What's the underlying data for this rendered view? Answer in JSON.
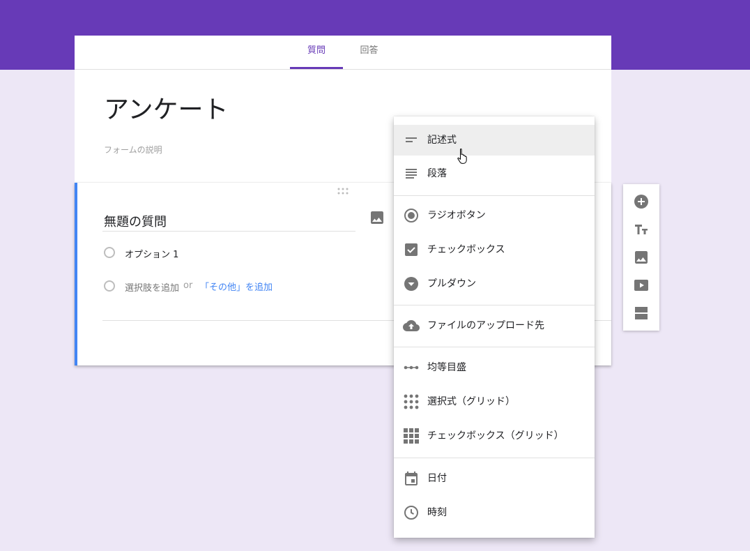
{
  "tabs": {
    "questions": "質問",
    "responses": "回答"
  },
  "form": {
    "title": "アンケート",
    "description_placeholder": "フォームの説明"
  },
  "question": {
    "title": "無題の質問",
    "option1": "オプション 1",
    "add_option": "選択肢を追加",
    "or": "or",
    "add_other": "「その他」を追加"
  },
  "menu": {
    "highlighted": "short_answer",
    "items": [
      {
        "label": "記述式",
        "icon": "short-text-icon"
      },
      {
        "label": "段落",
        "icon": "paragraph-icon"
      },
      {
        "label": "ラジオボタン",
        "icon": "radio-button-icon"
      },
      {
        "label": "チェックボックス",
        "icon": "checkbox-icon"
      },
      {
        "label": "プルダウン",
        "icon": "dropdown-icon"
      },
      {
        "label": "ファイルのアップロード先",
        "icon": "cloud-upload-icon"
      },
      {
        "label": "均等目盛",
        "icon": "linear-scale-icon"
      },
      {
        "label": "選択式（グリッド）",
        "icon": "grid-dots-icon"
      },
      {
        "label": "チェックボックス（グリッド）",
        "icon": "grid-squares-icon"
      },
      {
        "label": "日付",
        "icon": "calendar-icon"
      },
      {
        "label": "時刻",
        "icon": "clock-icon"
      }
    ]
  },
  "side_toolbar": [
    "add-question-icon",
    "title-text-icon",
    "image-icon",
    "video-icon",
    "section-icon"
  ],
  "colors": {
    "theme": "#673ab7",
    "background": "#ede7f6",
    "accent": "#4285f4"
  }
}
